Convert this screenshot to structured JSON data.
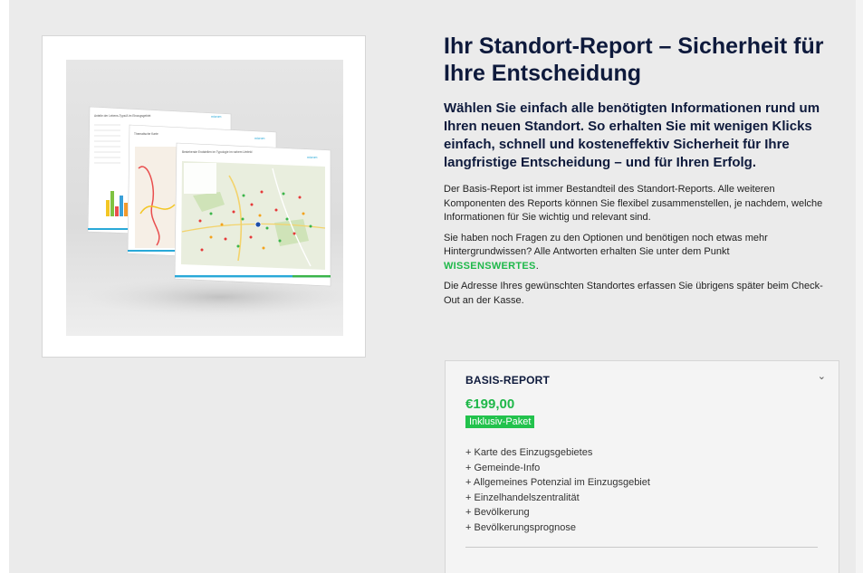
{
  "product": {
    "title": "Ihr Standort-Report – Sicherheit für Ihre Entscheidung",
    "lead": "Wählen Sie einfach alle benötigten Informationen rund um Ihren neuen Standort. So erhalten Sie mit wenigen Klicks einfach, schnell und kosteneffektiv Sicherheit für Ihre langfristige Entscheidung – und für Ihren Erfolg.",
    "paragraph_1": "Der Basis-Report ist immer Bestandteil des Standort-Reports. Alle weiteren Komponenten des Reports können Sie flexibel zusammenstellen, je nachdem, welche Informationen für Sie wichtig und relevant sind.",
    "paragraph_2_text": "Sie haben noch Fragen zu den Optionen und benötigen noch etwas mehr Hintergrundwissen? Alle Antworten erhalten Sie unter dem Punkt",
    "paragraph_2_link": "WISSENSWERTES",
    "paragraph_2_end": ".",
    "paragraph_3": "Die Adresse Ihres gewünschten Standortes erfassen Sie übrigens später beim Check-Out an der Kasse."
  },
  "report_option": {
    "title": "BASIS-REPORT",
    "chevron_icon": "chevron-down-icon",
    "price": "€199,00",
    "badge": "Inklusiv-Paket",
    "features": [
      "+ Karte des Einzugsgebietes",
      "+ Gemeinde-Info",
      "+ Allgemeines Potenzial im Einzugsgebiet",
      "+ Einzelhandelszentralität",
      "+ Bevölkerung",
      "+ Bevölkerungsprognose"
    ]
  },
  "mockup": {
    "brand": "microm",
    "header_back": "Anteile der Lebens-Typs/A im Einzugsgebiet",
    "header_mid": "Thematische Karte",
    "header_front": "Bestehende Endstellen im Typologie im nahem Umfeld"
  },
  "colors": {
    "accent_green": "#1fb84a",
    "badge_green": "#22c24c",
    "title_navy": "#0e1a3c",
    "panel_bg": "#ebebeb"
  }
}
